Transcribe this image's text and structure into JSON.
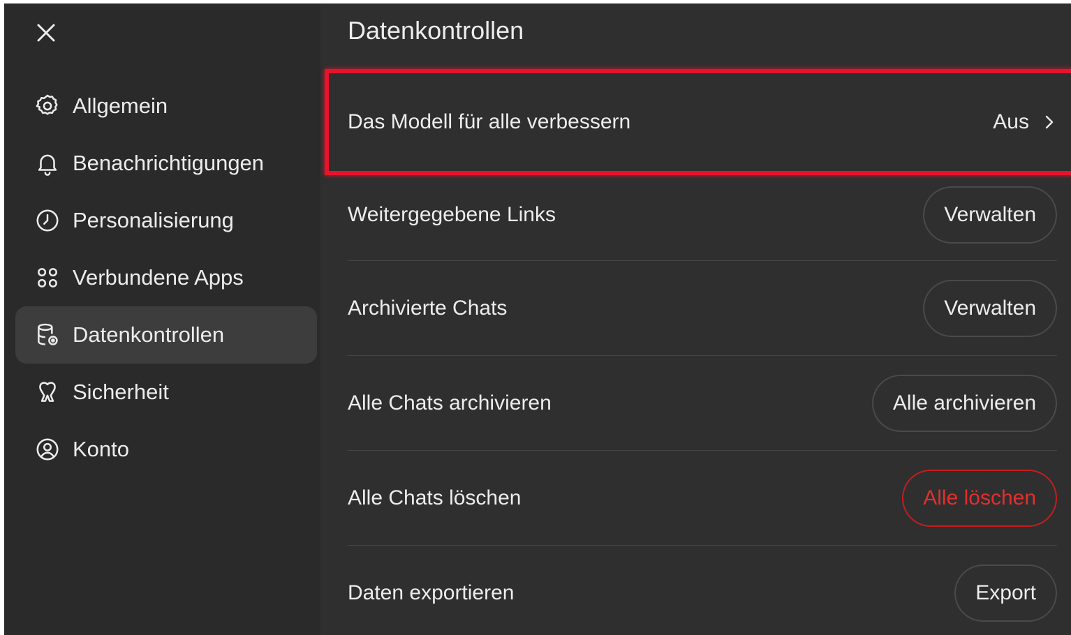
{
  "sidebar": {
    "items": [
      {
        "label": "Allgemein",
        "icon": "gear-icon"
      },
      {
        "label": "Benachrichtigungen",
        "icon": "bell-icon"
      },
      {
        "label": "Personalisierung",
        "icon": "personalization-icon"
      },
      {
        "label": "Verbundene Apps",
        "icon": "apps-icon"
      },
      {
        "label": "Datenkontrollen",
        "icon": "database-gear-icon",
        "active": true
      },
      {
        "label": "Sicherheit",
        "icon": "security-icon"
      },
      {
        "label": "Konto",
        "icon": "account-icon"
      }
    ]
  },
  "main": {
    "title": "Datenkontrollen",
    "rows": [
      {
        "label": "Das Modell für alle verbessern",
        "value": "Aus"
      },
      {
        "label": "Weitergegebene Links",
        "button": "Verwalten"
      },
      {
        "label": "Archivierte Chats",
        "button": "Verwalten"
      },
      {
        "label": "Alle Chats archivieren",
        "button": "Alle archivieren"
      },
      {
        "label": "Alle Chats löschen",
        "button": "Alle löschen"
      },
      {
        "label": "Daten exportieren",
        "button": "Export"
      }
    ]
  },
  "colors": {
    "background": "#2f2f2f",
    "sidebar": "#2a2a2a",
    "active_item": "#3d3d3d",
    "text": "#ececec",
    "danger": "#e0302e",
    "highlight_box": "#e5142a"
  }
}
